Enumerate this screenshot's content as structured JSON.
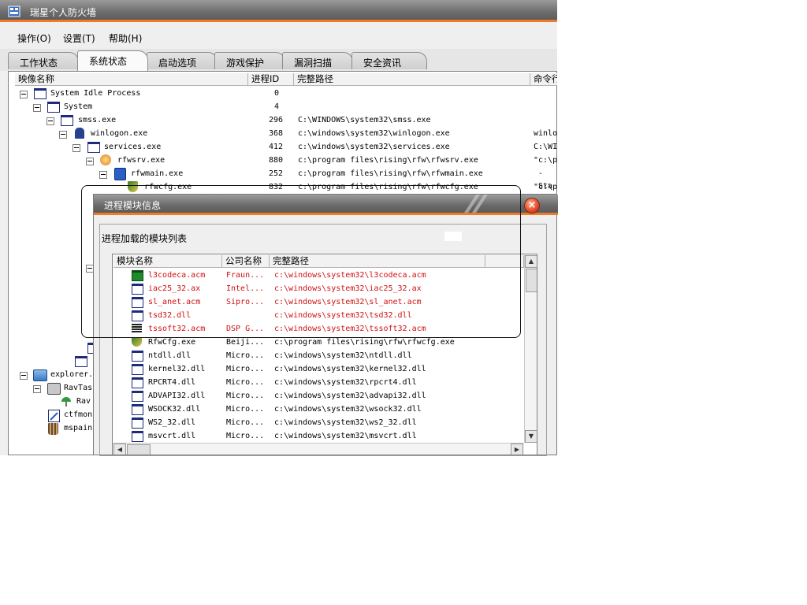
{
  "window": {
    "title": "瑞星个人防火墙",
    "accent": "#f07a2a"
  },
  "menu": [
    {
      "label": "操作(O)"
    },
    {
      "label": "设置(T)"
    },
    {
      "label": "帮助(H)"
    }
  ],
  "tabs": [
    {
      "label": "工作状态",
      "active": false
    },
    {
      "label": "系统状态",
      "active": true
    },
    {
      "label": "启动选项",
      "active": false
    },
    {
      "label": "游戏保护",
      "active": false
    },
    {
      "label": "漏洞扫描",
      "active": false
    },
    {
      "label": "安全资讯",
      "active": false
    }
  ],
  "process_columns": [
    "映像名称",
    "进程ID",
    "完整路径",
    "命令行"
  ],
  "processes": [
    {
      "name": "System Idle Process",
      "pid": "0",
      "path": "",
      "cmd": ""
    },
    {
      "name": "System",
      "pid": "4",
      "path": "",
      "cmd": ""
    },
    {
      "name": "smss.exe",
      "pid": "296",
      "path": "C:\\WINDOWS\\system32\\smss.exe",
      "cmd": ""
    },
    {
      "name": "winlogon.exe",
      "pid": "368",
      "path": "c:\\windows\\system32\\winlogon.exe",
      "cmd": "winlo"
    },
    {
      "name": "services.exe",
      "pid": "412",
      "path": "c:\\windows\\system32\\services.exe",
      "cmd": "C:\\WI"
    },
    {
      "name": "rfwsrv.exe",
      "pid": "880",
      "path": "c:\\program files\\rising\\rfw\\rfwsrv.exe",
      "cmd": "\"c:\\p"
    },
    {
      "name": "rfwmain.exe",
      "pid": "252",
      "path": "c:\\program files\\rising\\rfw\\rfwmain.exe",
      "cmd": "-Sta"
    },
    {
      "name": "rfwcfg.exe",
      "pid": "832",
      "path": "c:\\program files\\rising\\rfw\\rfwcfg.exe",
      "cmd": "\"c:\\p"
    },
    {
      "name": "explorer.",
      "pid": "",
      "path": "",
      "cmd": ""
    },
    {
      "name": "RavTas",
      "pid": "",
      "path": "",
      "cmd": ""
    },
    {
      "name": "Rav",
      "pid": "",
      "path": "",
      "cmd": ""
    },
    {
      "name": "ctfmon",
      "pid": "",
      "path": "",
      "cmd": ""
    },
    {
      "name": "mspain",
      "pid": "",
      "path": "",
      "cmd": ""
    }
  ],
  "dialog": {
    "title": "进程模块信息",
    "group_label": "进程加载的模块列表",
    "columns": [
      "模块名称",
      "公司名称",
      "完整路径"
    ],
    "modules": [
      {
        "name": "l3codeca.acm",
        "company": "Fraun...",
        "path": "c:\\windows\\system32\\l3codeca.acm",
        "red": true,
        "icon": "green-module-icon"
      },
      {
        "name": "iac25_32.ax",
        "company": "Intel...",
        "path": "c:\\windows\\system32\\iac25_32.ax",
        "red": true,
        "icon": "module-icon"
      },
      {
        "name": "sl_anet.acm",
        "company": "Sipro...",
        "path": "c:\\windows\\system32\\sl_anet.acm",
        "red": true,
        "icon": "module-icon"
      },
      {
        "name": "tsd32.dll",
        "company": "",
        "path": "c:\\windows\\system32\\tsd32.dll",
        "red": true,
        "icon": "module-icon"
      },
      {
        "name": "tssoft32.acm",
        "company": "DSP G...",
        "path": "c:\\windows\\system32\\tssoft32.acm",
        "red": true,
        "icon": "barcode-icon"
      },
      {
        "name": "RfwCfg.exe",
        "company": "Beiji...",
        "path": "c:\\program files\\rising\\rfw\\rfwcfg.exe",
        "red": false,
        "icon": "shield-icon"
      },
      {
        "name": "ntdll.dll",
        "company": "Micro...",
        "path": "c:\\windows\\system32\\ntdll.dll",
        "red": false,
        "icon": "module-icon"
      },
      {
        "name": "kernel32.dll",
        "company": "Micro...",
        "path": "c:\\windows\\system32\\kernel32.dll",
        "red": false,
        "icon": "module-icon"
      },
      {
        "name": "RPCRT4.dll",
        "company": "Micro...",
        "path": "c:\\windows\\system32\\rpcrt4.dll",
        "red": false,
        "icon": "module-icon"
      },
      {
        "name": "ADVAPI32.dll",
        "company": "Micro...",
        "path": "c:\\windows\\system32\\advapi32.dll",
        "red": false,
        "icon": "module-icon"
      },
      {
        "name": "WSOCK32.dll",
        "company": "Micro...",
        "path": "c:\\windows\\system32\\wsock32.dll",
        "red": false,
        "icon": "module-icon"
      },
      {
        "name": "WS2_32.dll",
        "company": "Micro...",
        "path": "c:\\windows\\system32\\ws2_32.dll",
        "red": false,
        "icon": "module-icon"
      },
      {
        "name": "msvcrt.dll",
        "company": "Micro...",
        "path": "c:\\windows\\system32\\msvcrt.dll",
        "red": false,
        "icon": "module-icon"
      }
    ]
  }
}
